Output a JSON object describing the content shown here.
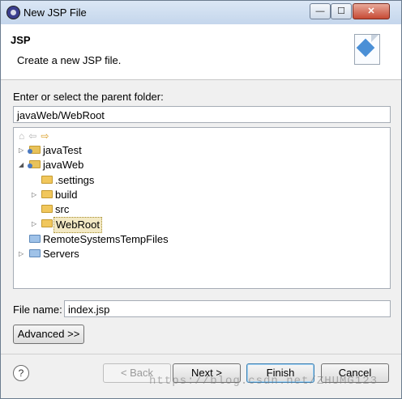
{
  "window": {
    "title": "New JSP File",
    "controls": {
      "minimize": "—",
      "maximize": "☐",
      "close": "✕"
    }
  },
  "header": {
    "title": "JSP",
    "subtitle": "Create a new JSP file."
  },
  "folder": {
    "label": "Enter or select the parent folder:",
    "value": "javaWeb/WebRoot"
  },
  "tree": {
    "nav_icons": [
      "home-icon",
      "back-icon",
      "forward-icon"
    ],
    "items": [
      {
        "label": "javaTest",
        "icon": "project-folder-icon"
      },
      {
        "label": "javaWeb",
        "icon": "project-folder-icon"
      },
      {
        "label": ".settings",
        "icon": "folder-icon"
      },
      {
        "label": "build",
        "icon": "folder-icon"
      },
      {
        "label": "src",
        "icon": "folder-icon"
      },
      {
        "label": "WebRoot",
        "icon": "folder-icon"
      },
      {
        "label": "RemoteSystemsTempFiles",
        "icon": "project-folder-icon"
      },
      {
        "label": "Servers",
        "icon": "project-folder-icon"
      }
    ]
  },
  "file_name": {
    "label": "File name:",
    "value": "index.jsp"
  },
  "buttons": {
    "advanced": "Advanced >>",
    "back": "< Back",
    "next": "Next >",
    "finish": "Finish",
    "cancel": "Cancel",
    "help": "?"
  },
  "watermark": "https://blog.csdn.net/ZHUMG123"
}
